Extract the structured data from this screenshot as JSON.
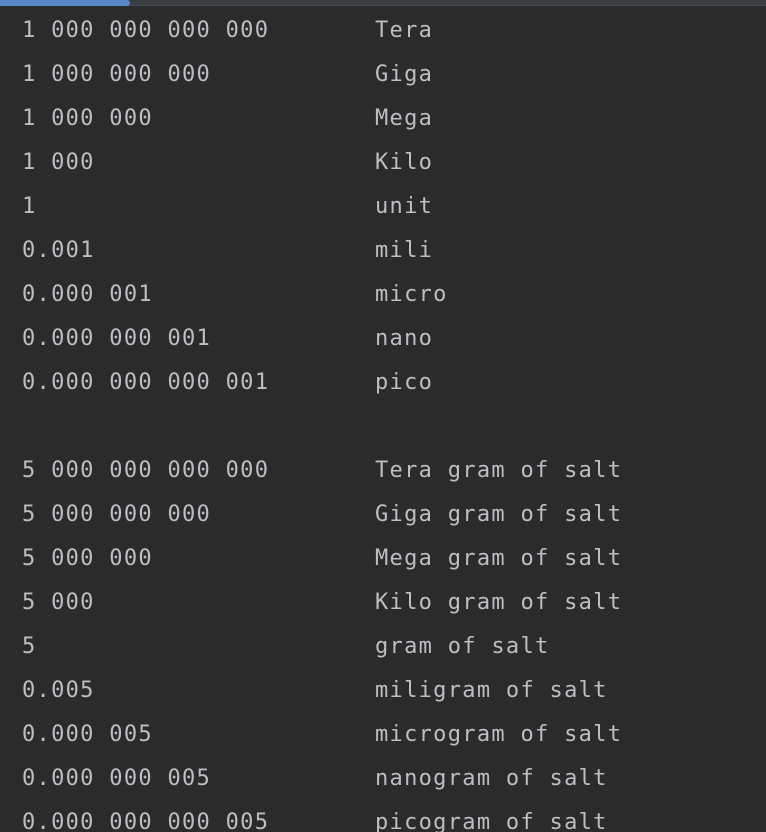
{
  "colors": {
    "background": "#2b2b2b",
    "text": "#bcbec4",
    "scroll_thumb": "#5a87c8"
  },
  "units": [
    {
      "value": "1 000 000 000 000",
      "name": "Tera"
    },
    {
      "value": "1 000 000 000",
      "name": "Giga"
    },
    {
      "value": "1 000 000",
      "name": "Mega"
    },
    {
      "value": "1 000",
      "name": "Kilo"
    },
    {
      "value": "1",
      "name": "unit"
    },
    {
      "value": "0.001",
      "name": "mili"
    },
    {
      "value": "0.000 001",
      "name": "micro"
    },
    {
      "value": "0.000 000 001",
      "name": "nano"
    },
    {
      "value": "0.000 000 000 001",
      "name": "pico"
    }
  ],
  "salt": [
    {
      "value": "5 000 000 000 000",
      "name": "Tera gram of salt"
    },
    {
      "value": "5 000 000 000",
      "name": "Giga gram of salt"
    },
    {
      "value": "5 000 000",
      "name": "Mega gram of salt"
    },
    {
      "value": "5 000",
      "name": "Kilo gram of salt"
    },
    {
      "value": "5",
      "name": "gram of salt"
    },
    {
      "value": "0.005",
      "name": "miligram of salt"
    },
    {
      "value": "0.000 005",
      "name": "microgram of salt"
    },
    {
      "value": "0.000 000 005",
      "name": "nanogram of salt"
    },
    {
      "value": "0.000 000 000 005",
      "name": "picogram of salt"
    }
  ]
}
